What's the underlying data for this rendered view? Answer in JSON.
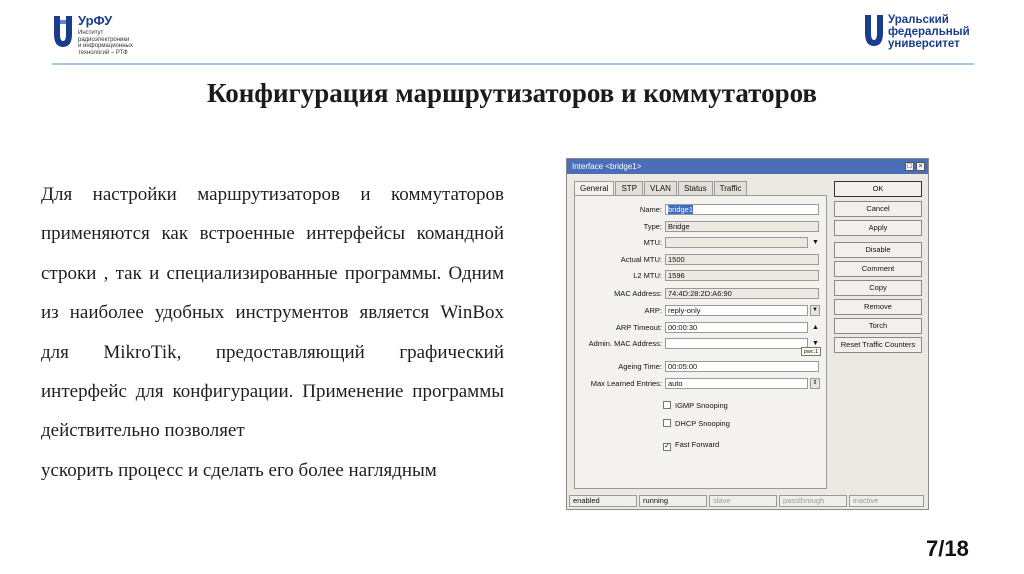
{
  "header": {
    "left_logo": {
      "brand": "УрФУ",
      "sub_lines": [
        "Институт",
        "радиоэлектроники",
        "и информационных",
        "технологий – РТФ"
      ]
    },
    "right_logo": {
      "lines": [
        "Уральский",
        "федеральный",
        "университет"
      ]
    },
    "accent_color": "#1a3c8c",
    "line_color": "#a8c4e8"
  },
  "slide": {
    "title": "Конфигурация маршрутизаторов и коммутаторов",
    "paragraph_main": "Для настройки маршрутизаторов и коммутаторов применяются как встроенные интерфейсы командной строки , так и специализированные программы. Одним из наиболее удобных инструментов является WinBox для MikroTik, предоставляющий графический интерфейс для конфигурации. Применение программы действительно позволяет",
    "paragraph_last": "ускорить процесс и сделать его более наглядным",
    "page_number": "7/18"
  },
  "winbox": {
    "title": "Interface <bridge1>",
    "title_bar_color": "#4b6eb7",
    "tabs": [
      "General",
      "STP",
      "VLAN",
      "Status",
      "Traffic"
    ],
    "active_tab": "General",
    "fields": {
      "name": {
        "label": "Name:",
        "value": "bridge1"
      },
      "type": {
        "label": "Type:",
        "value": "Bridge"
      },
      "mtu": {
        "label": "MTU:",
        "value": ""
      },
      "actual_mtu": {
        "label": "Actual MTU:",
        "value": "1500"
      },
      "l2_mtu": {
        "label": "L2 MTU:",
        "value": "1596"
      },
      "mac": {
        "label": "MAC Address:",
        "value": "74:4D:28:2D:A6:90"
      },
      "arp": {
        "label": "ARP:",
        "value": "reply-only"
      },
      "arp_timeout": {
        "label": "ARP Timeout:",
        "value": "00:00:30"
      },
      "admin_mac": {
        "label": "Admin. MAC Address:",
        "value": ""
      },
      "ageing_time": {
        "label": "Ageing Time:",
        "value": "00:05:00"
      },
      "max_learned": {
        "label": "Max Learned Entries:",
        "value": "auto"
      }
    },
    "checkboxes": {
      "igmp": {
        "label": "IGMP Snooping",
        "checked": false
      },
      "dhcp": {
        "label": "DHCP Snooping",
        "checked": false
      },
      "fast_forward": {
        "label": "Fast Forward",
        "checked": true
      }
    },
    "tooltip": "pwc.1",
    "buttons": {
      "ok": "OK",
      "cancel": "Cancel",
      "apply": "Apply",
      "disable": "Disable",
      "comment": "Comment",
      "copy": "Copy",
      "remove": "Remove",
      "torch": "Torch",
      "reset_traffic": "Reset Traffic Counters"
    },
    "status": [
      "enabled",
      "running",
      "slave",
      "passthrough",
      "inactive"
    ]
  }
}
